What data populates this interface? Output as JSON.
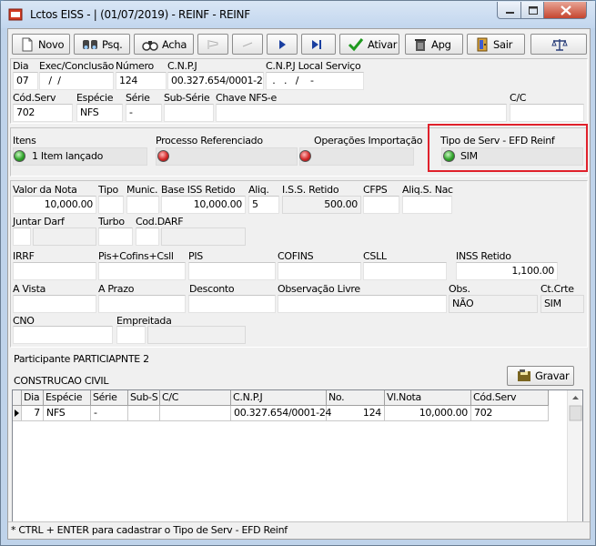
{
  "window": {
    "title": "Lctos EISS - | (01/07/2019) - REINF - REINF"
  },
  "toolbar": {
    "novo": "Novo",
    "psq": "Psq.",
    "acha": "Acha",
    "ativar": "Ativar",
    "apg": "Apg",
    "sair": "Sair"
  },
  "header": {
    "dia_label": "Dia",
    "dia": "07",
    "exec_label": "Exec/Conclusão",
    "exec": "  /  /",
    "numero_label": "Número",
    "numero": "124",
    "cnpj_label": "C.N.P.J",
    "cnpj": "00.327.654/0001-24",
    "cnpj_local_label": "C.N.P.J Local Serviço",
    "cnpj_local": " .   .   /    -",
    "cod_serv_label": "Cód.Serv",
    "cod_serv": "702",
    "especie_label": "Espécie",
    "especie": "NFS",
    "serie_label": "Série",
    "serie": "-",
    "sub_serie_label": "Sub-Série",
    "sub_serie": "",
    "chave_label": "Chave NFS-e",
    "chave": "",
    "cc_label": "C/C",
    "cc": ""
  },
  "status_row": {
    "itens_label": "Itens",
    "itens": "1 Item lançado",
    "proc_label": "Processo Referenciado",
    "proc": "",
    "import_label": "Operações Importação",
    "import": "",
    "tipo_label": "Tipo de Serv - EFD Reinf",
    "tipo": "SIM"
  },
  "values": {
    "valor_nota_label": "Valor da Nota",
    "valor_nota": "10,000.00",
    "tipo_label": "Tipo",
    "tipo": "",
    "munic_label": "Munic.",
    "munic": "",
    "base_label": "Base ISS Retido",
    "base": "10,000.00",
    "aliq_label": "Aliq.",
    "aliq": "5",
    "iss_label": "I.S.S. Retido",
    "iss": "500.00",
    "cfps_label": "CFPS",
    "cfps": "",
    "aliq_nac_label": "Aliq.S. Nac",
    "aliq_nac": "",
    "juntar_label": "Juntar Darf",
    "turbo_label": "Turbo",
    "cod_darf_label": "Cod.DARF",
    "irrf_label": "IRRF",
    "irrf": "",
    "pcc_label": "Pis+Cofins+Csll",
    "pcc": "",
    "pis_label": "PIS",
    "pis": "",
    "cofins_label": "COFINS",
    "cofins": "",
    "csll_label": "CSLL",
    "csll": "",
    "inss_label": "INSS Retido",
    "inss": "1,100.00",
    "avista_label": "A Vista",
    "avista": "",
    "aprazo_label": "A Prazo",
    "aprazo": "",
    "desconto_label": "Desconto",
    "desconto": "",
    "obs_livre_label": "Observação Livre",
    "obs_livre": "",
    "obs_label": "Obs.",
    "obs": "NÃO",
    "ctcrte_label": "Ct.Crte",
    "ctcrte": "SIM",
    "cno_label": "CNO",
    "cno": "",
    "empreitada_label": "Empreitada",
    "empreitada": ""
  },
  "participante": {
    "label": "Participante PARTICIAPNTE 2",
    "obra": "CONSTRUCAO CIVIL",
    "gravar": "Gravar"
  },
  "grid": {
    "columns": [
      "Dia",
      "Espécie",
      "Série",
      "Sub-S",
      "C/C",
      "C.N.P.J",
      "No.",
      "Vl.Nota",
      "Cód.Serv"
    ],
    "rows": [
      [
        "7",
        "NFS",
        "-",
        "",
        "",
        "00.327.654/0001-24",
        "124",
        "10,000.00",
        "702"
      ]
    ]
  },
  "statusbar": "* CTRL + ENTER para  cadastrar o Tipo de Serv - EFD Reinf",
  "colors": {
    "highlight": "#e0212b",
    "led_green": "#2fa42a",
    "led_red": "#d42a2a"
  }
}
